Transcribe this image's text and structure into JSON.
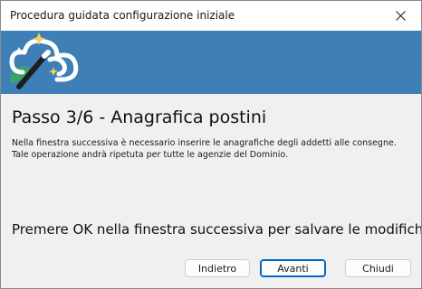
{
  "window": {
    "title": "Procedura guidata configurazione iniziale"
  },
  "banner": {
    "logo_icon": "cloud-magic-wand-icon",
    "background_color": "#3f7fb8"
  },
  "content": {
    "heading": "Passo 3/6 - Anagrafica postini",
    "description_line1": "Nella finestra successiva è necessario inserire le anagrafiche degli addetti alle consegne.",
    "description_line2": "Tale operazione andrà ripetuta per tutte le agenzie del Dominio.",
    "footer_note": "Premere OK nella finestra successiva per salvare le modifiche."
  },
  "buttons": {
    "back_label": "Indietro",
    "next_label": "Avanti",
    "close_label": "Chiudi"
  },
  "colors": {
    "accent": "#0067c0"
  }
}
